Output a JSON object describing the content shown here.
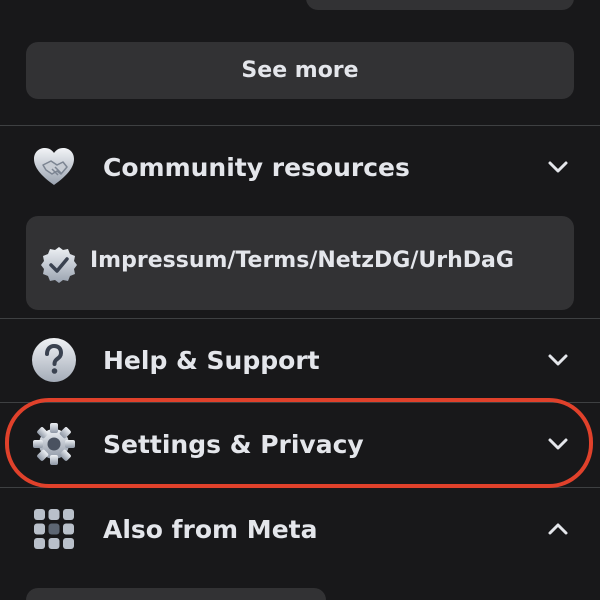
{
  "see_more": {
    "label": "See more"
  },
  "menu": {
    "community": {
      "label": "Community resources",
      "icon": "handshake-heart-icon",
      "expanded": false
    },
    "terms": {
      "label": "Impressum/Terms/NetzDG/UrhDaG",
      "icon": "verified-badge-icon"
    },
    "help": {
      "label": "Help & Support",
      "icon": "question-icon",
      "expanded": false
    },
    "settings": {
      "label": "Settings & Privacy",
      "icon": "gear-icon",
      "expanded": false
    },
    "meta": {
      "label": "Also from Meta",
      "icon": "apps-grid-icon",
      "expanded": true
    }
  },
  "annotation": {
    "color": "#e0412b",
    "target": "Settings & Privacy"
  }
}
